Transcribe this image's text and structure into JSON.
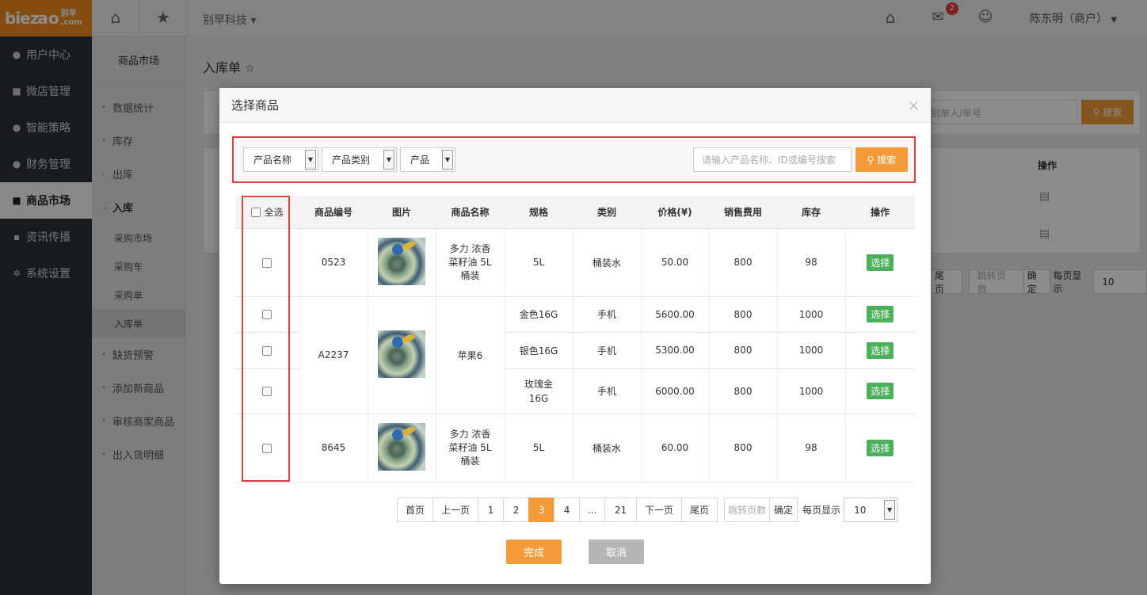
{
  "header": {
    "logo_text": "biez",
    "logo_sub1": "别早",
    "logo_sub2": ".com",
    "company": "别早科技 ▾",
    "notification_count": "2",
    "user": "陈东明（商户）"
  },
  "sidebar": {
    "items": [
      {
        "label": "用户中心",
        "icon": "user-icon"
      },
      {
        "label": "微店管理",
        "icon": "shop-icon"
      },
      {
        "label": "智能策略",
        "icon": "strategy-icon"
      },
      {
        "label": "财务管理",
        "icon": "finance-icon"
      },
      {
        "label": "商品市场",
        "icon": "market-icon"
      },
      {
        "label": "资讯传播",
        "icon": "news-icon"
      },
      {
        "label": "系统设置",
        "icon": "gear-icon"
      }
    ]
  },
  "subsidebar": {
    "title": "商品市场",
    "items": [
      "数据统计",
      "库存",
      "出库",
      "入库",
      "采购市场",
      "采购车",
      "采购单",
      "入库单",
      "缺货预警",
      "添加新商品",
      "审核商家商品",
      "出入货明细"
    ]
  },
  "page": {
    "title": "入库单",
    "bg_search_placeholder": "别单人/单号",
    "bg_search_btn": "搜索",
    "bg_op_header": "操作",
    "bg_last": "尾页",
    "bg_jump": "跳转页数",
    "bg_confirm": "确定",
    "bg_pagesize_label": "每页显示",
    "bg_pagesize": "10"
  },
  "modal": {
    "title": "选择商品",
    "close": "×",
    "filters": {
      "product_name": "产品名称",
      "product_category": "产品类别",
      "product": "产品",
      "search_placeholder": "请输入产品名称、ID或编号搜索",
      "search_btn": "搜索"
    },
    "table": {
      "headers": [
        "全选",
        "商品编号",
        "图片",
        "商品名称",
        "规格",
        "类别",
        "价格(¥)",
        "销售费用",
        "库存",
        "操作"
      ],
      "rows": [
        {
          "code": "0523",
          "name": "多力 浓香菜籽油 5L 桶装",
          "spec": "5L",
          "category": "桶装水",
          "price": "50.00",
          "fee": "800",
          "stock": "98",
          "action": "选择"
        },
        {
          "code": "A2237",
          "name": "苹果6",
          "spec": "金色16G",
          "category": "手机",
          "price": "5600.00",
          "fee": "800",
          "stock": "1000",
          "action": "选择"
        },
        {
          "spec": "银色16G",
          "category": "手机",
          "price": "5300.00",
          "fee": "800",
          "stock": "1000",
          "action": "选择"
        },
        {
          "spec": "玫瑰金 16G",
          "category": "手机",
          "price": "6000.00",
          "fee": "800",
          "stock": "1000",
          "action": "选择"
        },
        {
          "code": "8645",
          "name": "多力 浓香菜籽油 5L 桶装",
          "spec": "5L",
          "category": "桶装水",
          "price": "60.00",
          "fee": "800",
          "stock": "98",
          "action": "选择"
        }
      ]
    },
    "pagination": {
      "first": "首页",
      "prev": "上一页",
      "pages": [
        "1",
        "2",
        "3",
        "4",
        "...",
        "21"
      ],
      "current": "3",
      "next": "下一页",
      "last": "尾页",
      "jump_placeholder": "跳转页数",
      "confirm": "确定",
      "pagesize_label": "每页显示",
      "pagesize": "10"
    },
    "done": "完成",
    "cancel": "取消"
  },
  "colors": {
    "accent": "#f29b38",
    "logo": "#f18c1d",
    "sidebar": "#2c3036",
    "highlight": "#e04040",
    "select_btn": "#4cb05a"
  }
}
